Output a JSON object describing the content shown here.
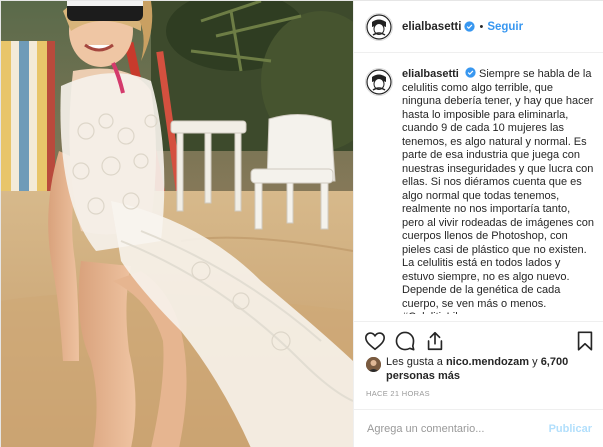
{
  "header": {
    "username": "elialbasetti",
    "separator": "•",
    "follow_label": "Seguir"
  },
  "caption": {
    "username": "elialbasetti",
    "text": "Siempre se habla de la celulitis como algo terrible, que ninguna debería tener, y hay que hacer hasta lo imposible para eliminarla, cuando 9 de cada 10 mujeres las tenemos, es algo natural y normal. Es parte de esa industria que juega con nuestras inseguridades y que lucra con ellas. Si nos diéramos cuenta que es algo normal que todas tenemos, realmente no nos importaría tanto, pero al vivir rodeadas de imágenes con cuerpos llenos de Photoshop, con pieles casi de plástico que no existen. La celulitis está en todos lados y estuvo siempre, no es algo nuevo. Depende de la genética de cada cuerpo, se ven más o menos. #CelulitisLibre"
  },
  "likes": {
    "prefix": "Les gusta a",
    "user": "nico.mendozam",
    "conjunction": "y",
    "count": "6,700 personas más"
  },
  "timestamp": "HACE 21 HORAS",
  "comment_box": {
    "placeholder": "Agrega un comentario...",
    "publish_label": "Publicar"
  },
  "icons": {
    "like": "heart-icon",
    "comment": "comment-icon",
    "share": "share-icon",
    "save": "bookmark-icon",
    "verified": "verified-badge-icon"
  },
  "colors": {
    "link_blue": "#3897f0",
    "publish_disabled": "#b2dffc",
    "verified_blue": "#3897f0",
    "text": "#262626",
    "muted": "#999999"
  }
}
